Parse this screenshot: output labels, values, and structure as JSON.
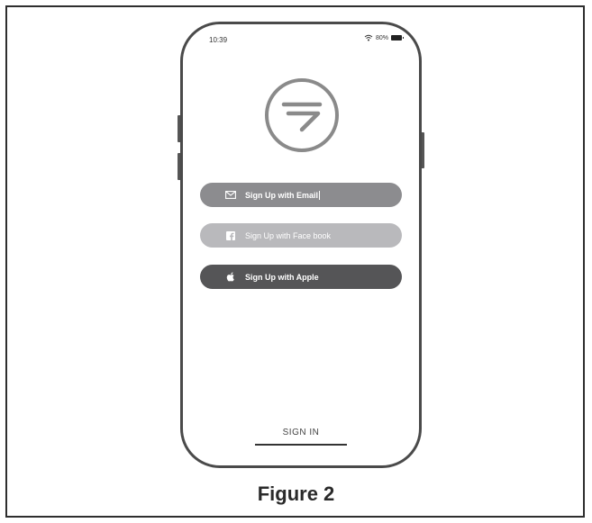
{
  "status_bar": {
    "time": "10:39",
    "battery_text": "80%",
    "wifi_icon": "wifi-icon",
    "battery_icon": "battery-icon"
  },
  "logo": {
    "icon": "app-logo-icon"
  },
  "buttons": {
    "email": {
      "label": "Sign Up with Email",
      "icon": "envelope-icon"
    },
    "facebook": {
      "label": "Sign Up with Face book",
      "icon": "facebook-icon"
    },
    "apple": {
      "label": "Sign Up with Apple",
      "icon": "apple-icon"
    }
  },
  "signin": {
    "label": "SIGN IN"
  },
  "caption": {
    "text": "Figure 2"
  },
  "colors": {
    "email_button": "#8c8c8f",
    "facebook_button": "#b9b9bc",
    "apple_button": "#555557",
    "phone_outline": "#4a4a4a"
  }
}
